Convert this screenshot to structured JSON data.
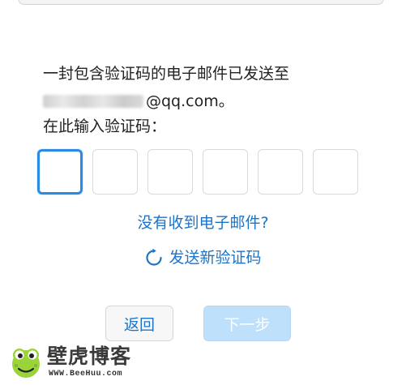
{
  "colors": {
    "accent": "#1d74c6",
    "active_border": "#2b8ae4",
    "next_button_bg": "#bfe0fb"
  },
  "message": {
    "line1": "一封包含验证码的电子邮件已发送至",
    "email_domain": "@qq.com。",
    "line3": "在此输入验证码："
  },
  "code_inputs": {
    "count": 6,
    "active_index": 0
  },
  "links": {
    "no_email": "没有收到电子邮件?",
    "resend": "发送新验证码",
    "resend_icon": "refresh-icon"
  },
  "buttons": {
    "back": "返回",
    "next": "下一步"
  },
  "watermark": {
    "title": "壁虎博客",
    "url": "WWW.BeeHuu.com",
    "icon": "gecko-logo-icon"
  }
}
